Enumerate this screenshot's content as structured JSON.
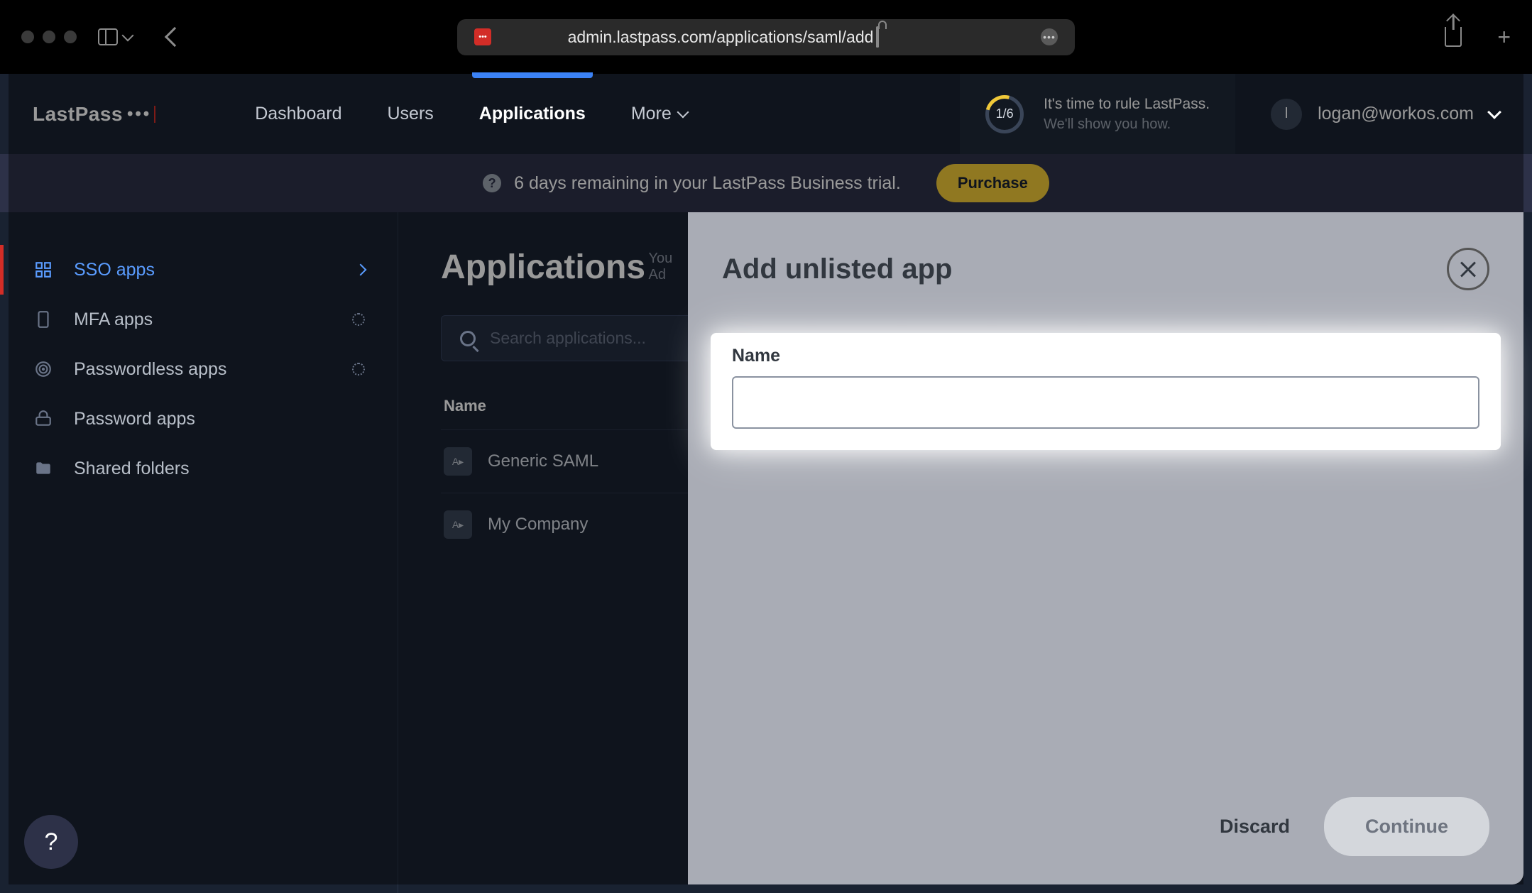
{
  "browser": {
    "url": "admin.lastpass.com/applications/saml/add"
  },
  "header": {
    "logo": "LastPass",
    "nav": {
      "dashboard": "Dashboard",
      "users": "Users",
      "applications": "Applications",
      "more": "More"
    },
    "progress": {
      "counter": "1/6",
      "line1": "It's time to rule LastPass.",
      "line2": "We'll show you how."
    },
    "user": {
      "initial": "l",
      "email": "logan@workos.com"
    }
  },
  "trial_banner": {
    "text": "6 days remaining in your LastPass Business trial.",
    "button": "Purchase"
  },
  "sidebar": {
    "items": [
      {
        "label": "SSO apps"
      },
      {
        "label": "MFA apps"
      },
      {
        "label": "Passwordless apps"
      },
      {
        "label": "Password apps"
      },
      {
        "label": "Shared folders"
      }
    ]
  },
  "page": {
    "title": "Applications",
    "subtitle_top": "You",
    "subtitle_bottom": "Ad",
    "search_placeholder": "Search applications...",
    "table": {
      "header": "Name",
      "rows": [
        {
          "name": "Generic SAML"
        },
        {
          "name": "My Company"
        }
      ]
    }
  },
  "modal": {
    "title": "Add unlisted app",
    "name_label": "Name",
    "name_value": "",
    "discard": "Discard",
    "continue": "Continue"
  },
  "help": "?"
}
